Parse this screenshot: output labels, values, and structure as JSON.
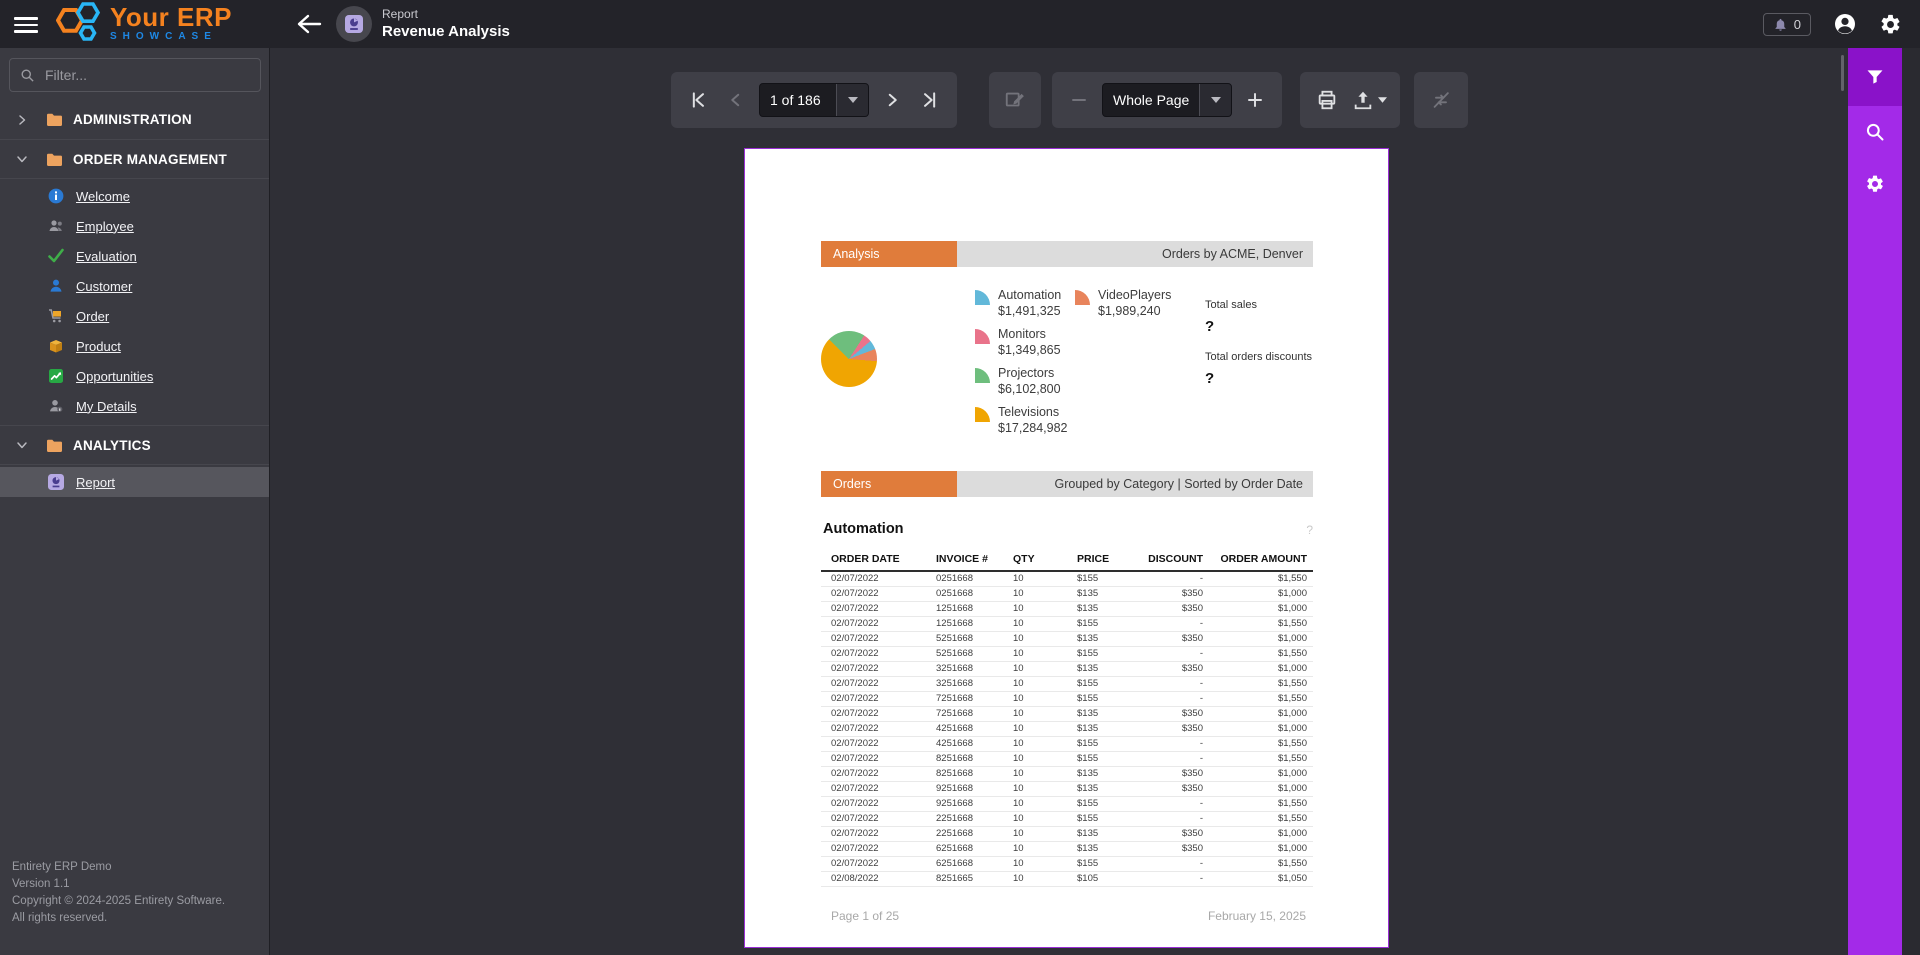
{
  "topbar": {
    "logo_primary": "Your ERP",
    "logo_secondary": "SHOWCASE",
    "context_label": "Report",
    "context_title": "Revenue Analysis",
    "notification_count": "0"
  },
  "sidebar": {
    "filter_placeholder": "Filter...",
    "sections": [
      {
        "label": "ADMINISTRATION"
      },
      {
        "label": "ORDER MANAGEMENT",
        "items": [
          {
            "label": "Welcome"
          },
          {
            "label": "Employee"
          },
          {
            "label": "Evaluation"
          },
          {
            "label": "Customer"
          },
          {
            "label": "Order"
          },
          {
            "label": "Product"
          },
          {
            "label": "Opportunities"
          },
          {
            "label": "My Details"
          }
        ]
      },
      {
        "label": "ANALYTICS",
        "items": [
          {
            "label": "Report",
            "selected": true
          }
        ]
      }
    ],
    "footer_lines": [
      "Entirety ERP Demo",
      "Version 1.1",
      "Copyright © 2024-2025 Entirety Software.",
      "All rights reserved."
    ]
  },
  "toolbar": {
    "page_value": "1 of 186",
    "zoom_value": "Whole Page"
  },
  "report": {
    "analysis_tab": "Analysis",
    "analysis_caption": "Orders by ACME, Denver",
    "orders_tab": "Orders",
    "orders_caption": "Grouped by Category | Sorted by Order Date",
    "legend": {
      "col1": [
        {
          "label": "Automation",
          "value": "$1,491,325",
          "color": "#62b8d9"
        },
        {
          "label": "Monitors",
          "value": "$1,349,865",
          "color": "#e9738a"
        },
        {
          "label": "Projectors",
          "value": "$6,102,800",
          "color": "#6ebe7d"
        },
        {
          "label": "Televisions",
          "value": "$17,284,982",
          "color": "#f0a502"
        }
      ],
      "col2": [
        {
          "label": "VideoPlayers",
          "value": "$1,989,240",
          "color": "#e8845c"
        }
      ]
    },
    "totals": {
      "sales_label": "Total sales",
      "sales_value": "?",
      "discount_label": "Total orders discounts",
      "discount_value": "?"
    },
    "group_title": "Automation",
    "group_hint": "?",
    "table": {
      "columns": [
        "ORDER DATE",
        "INVOICE #",
        "QTY",
        "PRICE",
        "DISCOUNT",
        "ORDER AMOUNT"
      ],
      "rows": [
        [
          "02/07/2022",
          "0251668",
          "10",
          "$155",
          "-",
          "$1,550"
        ],
        [
          "02/07/2022",
          "0251668",
          "10",
          "$135",
          "$350",
          "$1,000"
        ],
        [
          "02/07/2022",
          "1251668",
          "10",
          "$135",
          "$350",
          "$1,000"
        ],
        [
          "02/07/2022",
          "1251668",
          "10",
          "$155",
          "-",
          "$1,550"
        ],
        [
          "02/07/2022",
          "5251668",
          "10",
          "$135",
          "$350",
          "$1,000"
        ],
        [
          "02/07/2022",
          "5251668",
          "10",
          "$155",
          "-",
          "$1,550"
        ],
        [
          "02/07/2022",
          "3251668",
          "10",
          "$135",
          "$350",
          "$1,000"
        ],
        [
          "02/07/2022",
          "3251668",
          "10",
          "$155",
          "-",
          "$1,550"
        ],
        [
          "02/07/2022",
          "7251668",
          "10",
          "$155",
          "-",
          "$1,550"
        ],
        [
          "02/07/2022",
          "7251668",
          "10",
          "$135",
          "$350",
          "$1,000"
        ],
        [
          "02/07/2022",
          "4251668",
          "10",
          "$135",
          "$350",
          "$1,000"
        ],
        [
          "02/07/2022",
          "4251668",
          "10",
          "$155",
          "-",
          "$1,550"
        ],
        [
          "02/07/2022",
          "8251668",
          "10",
          "$155",
          "-",
          "$1,550"
        ],
        [
          "02/07/2022",
          "8251668",
          "10",
          "$135",
          "$350",
          "$1,000"
        ],
        [
          "02/07/2022",
          "9251668",
          "10",
          "$135",
          "$350",
          "$1,000"
        ],
        [
          "02/07/2022",
          "9251668",
          "10",
          "$155",
          "-",
          "$1,550"
        ],
        [
          "02/07/2022",
          "2251668",
          "10",
          "$155",
          "-",
          "$1,550"
        ],
        [
          "02/07/2022",
          "2251668",
          "10",
          "$135",
          "$350",
          "$1,000"
        ],
        [
          "02/07/2022",
          "6251668",
          "10",
          "$135",
          "$350",
          "$1,000"
        ],
        [
          "02/07/2022",
          "6251668",
          "10",
          "$155",
          "-",
          "$1,550"
        ],
        [
          "02/08/2022",
          "8251665",
          "10",
          "$105",
          "-",
          "$1,050"
        ]
      ]
    },
    "page_footer": {
      "page": "Page 1 of 25",
      "date": "February 15, 2025"
    }
  },
  "chart_data": {
    "type": "pie",
    "title": "Orders by ACME, Denver",
    "categories": [
      "Automation",
      "VideoPlayers",
      "Monitors",
      "Projectors",
      "Televisions"
    ],
    "values": [
      1491325,
      1989240,
      1349865,
      6102800,
      17284982
    ],
    "value_labels": [
      "$1,491,325",
      "$1,989,240",
      "$1,349,865",
      "$6,102,800",
      "$17,284,982"
    ],
    "legend_position": "right",
    "start_angle_deg": -45,
    "slices": [
      {
        "name": "Projectors",
        "color": "#6ebe7d",
        "value": 6102800
      },
      {
        "name": "Monitors",
        "color": "#e9738a",
        "value": 1349865
      },
      {
        "name": "Automation",
        "color": "#62b8d9",
        "value": 1491325
      },
      {
        "name": "VideoPlayers",
        "color": "#e8845c",
        "value": 1989240
      },
      {
        "name": "Televisions",
        "color": "#f0a502",
        "value": 17284982
      }
    ]
  }
}
